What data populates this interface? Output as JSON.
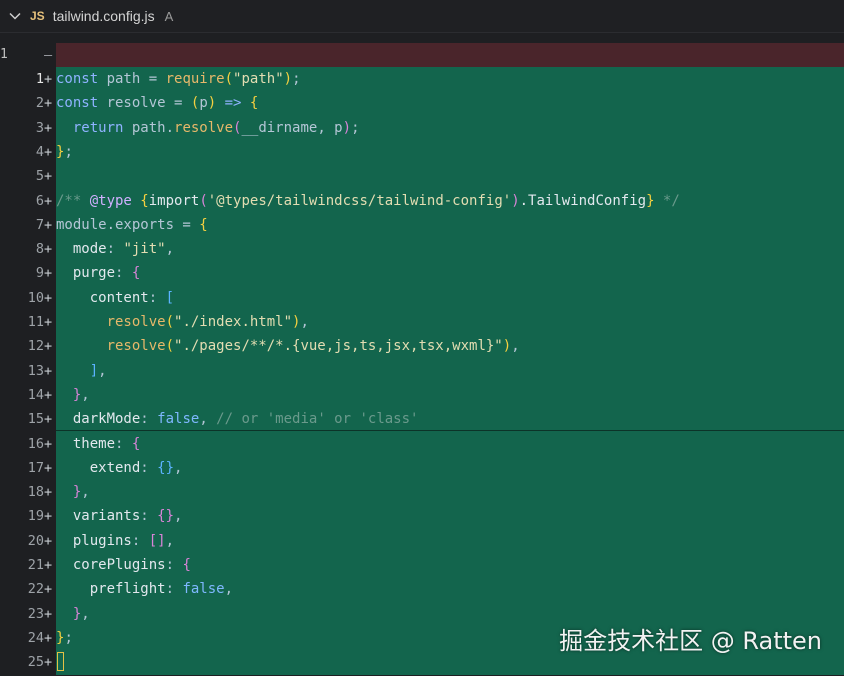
{
  "tab": {
    "lang_badge": "JS",
    "file_name": "tailwind.config.js",
    "status": "A"
  },
  "deleted_line": {
    "orig_number": "1",
    "sign": "–"
  },
  "watermark": "掘金技术社区 @ Ratten",
  "lines": [
    {
      "n": "1",
      "tokens": [
        [
          "kw",
          "const "
        ],
        [
          "plain",
          "path = "
        ],
        [
          "fn",
          "require"
        ],
        [
          "br1",
          "("
        ],
        [
          "str",
          "\"path\""
        ],
        [
          "br1",
          ")"
        ],
        [
          "plain",
          ";"
        ]
      ]
    },
    {
      "n": "2",
      "tokens": [
        [
          "kw",
          "const "
        ],
        [
          "plain",
          "resolve = "
        ],
        [
          "br1",
          "("
        ],
        [
          "plain",
          "p"
        ],
        [
          "br1",
          ")"
        ],
        [
          "kw",
          " => "
        ],
        [
          "br1",
          "{"
        ]
      ]
    },
    {
      "n": "3",
      "tokens": [
        [
          "kw",
          "  return "
        ],
        [
          "plain",
          "path."
        ],
        [
          "fn",
          "resolve"
        ],
        [
          "br2",
          "("
        ],
        [
          "plain",
          "__dirname, p"
        ],
        [
          "br2",
          ")"
        ],
        [
          "plain",
          ";"
        ]
      ]
    },
    {
      "n": "4",
      "tokens": [
        [
          "br1",
          "}"
        ],
        [
          "plain",
          ";"
        ]
      ]
    },
    {
      "n": "5",
      "tokens": []
    },
    {
      "n": "6",
      "tokens": [
        [
          "cm",
          "/** "
        ],
        [
          "dtag",
          "@type "
        ],
        [
          "br1",
          "{"
        ],
        [
          "prop",
          "import"
        ],
        [
          "br2",
          "("
        ],
        [
          "str",
          "'@types/tailwindcss/tailwind-config'"
        ],
        [
          "br2",
          ")"
        ],
        [
          "prop",
          ".TailwindConfig"
        ],
        [
          "br1",
          "}"
        ],
        [
          "cm",
          " */"
        ]
      ]
    },
    {
      "n": "7",
      "tokens": [
        [
          "plain",
          "module.exports = "
        ],
        [
          "br1",
          "{"
        ]
      ]
    },
    {
      "n": "8",
      "tokens": [
        [
          "prop",
          "  mode"
        ],
        [
          "plain",
          ": "
        ],
        [
          "str",
          "\"jit\""
        ],
        [
          "plain",
          ","
        ]
      ]
    },
    {
      "n": "9",
      "tokens": [
        [
          "prop",
          "  purge"
        ],
        [
          "plain",
          ": "
        ],
        [
          "br2",
          "{"
        ]
      ]
    },
    {
      "n": "10",
      "tokens": [
        [
          "prop",
          "    content"
        ],
        [
          "plain",
          ": "
        ],
        [
          "br3",
          "["
        ]
      ]
    },
    {
      "n": "11",
      "tokens": [
        [
          "fn",
          "      resolve"
        ],
        [
          "br1",
          "("
        ],
        [
          "str",
          "\"./index.html\""
        ],
        [
          "br1",
          ")"
        ],
        [
          "plain",
          ","
        ]
      ]
    },
    {
      "n": "12",
      "tokens": [
        [
          "fn",
          "      resolve"
        ],
        [
          "br1",
          "("
        ],
        [
          "str",
          "\"./pages/**/*.{vue,js,ts,jsx,tsx,wxml}\""
        ],
        [
          "br1",
          ")"
        ],
        [
          "plain",
          ","
        ]
      ]
    },
    {
      "n": "13",
      "tokens": [
        [
          "br3",
          "    ]"
        ],
        [
          "plain",
          ","
        ]
      ]
    },
    {
      "n": "14",
      "tokens": [
        [
          "br2",
          "  }"
        ],
        [
          "plain",
          ","
        ]
      ]
    },
    {
      "n": "15",
      "tokens": [
        [
          "prop",
          "  darkMode"
        ],
        [
          "plain",
          ": "
        ],
        [
          "bool",
          "false"
        ],
        [
          "plain",
          ", "
        ],
        [
          "cm",
          "// or 'media' or 'class'"
        ]
      ]
    },
    {
      "n": "16",
      "tokens": [
        [
          "prop",
          "  theme"
        ],
        [
          "plain",
          ": "
        ],
        [
          "br2",
          "{"
        ]
      ]
    },
    {
      "n": "17",
      "tokens": [
        [
          "prop",
          "    extend"
        ],
        [
          "plain",
          ": "
        ],
        [
          "br3",
          "{}"
        ],
        [
          "plain",
          ","
        ]
      ]
    },
    {
      "n": "18",
      "tokens": [
        [
          "br2",
          "  }"
        ],
        [
          "plain",
          ","
        ]
      ]
    },
    {
      "n": "19",
      "tokens": [
        [
          "prop",
          "  variants"
        ],
        [
          "plain",
          ": "
        ],
        [
          "br2",
          "{}"
        ],
        [
          "plain",
          ","
        ]
      ]
    },
    {
      "n": "20",
      "tokens": [
        [
          "prop",
          "  plugins"
        ],
        [
          "plain",
          ": "
        ],
        [
          "br2",
          "[]"
        ],
        [
          "plain",
          ","
        ]
      ]
    },
    {
      "n": "21",
      "tokens": [
        [
          "prop",
          "  corePlugins"
        ],
        [
          "plain",
          ": "
        ],
        [
          "br2",
          "{"
        ]
      ]
    },
    {
      "n": "22",
      "tokens": [
        [
          "prop",
          "    preflight"
        ],
        [
          "plain",
          ": "
        ],
        [
          "bool",
          "false"
        ],
        [
          "plain",
          ","
        ]
      ]
    },
    {
      "n": "23",
      "tokens": [
        [
          "br2",
          "  }"
        ],
        [
          "plain",
          ","
        ]
      ]
    },
    {
      "n": "24",
      "tokens": [
        [
          "br1",
          "}"
        ],
        [
          "plain",
          ";"
        ]
      ]
    },
    {
      "n": "25",
      "tokens": []
    }
  ],
  "added_sign": "+"
}
